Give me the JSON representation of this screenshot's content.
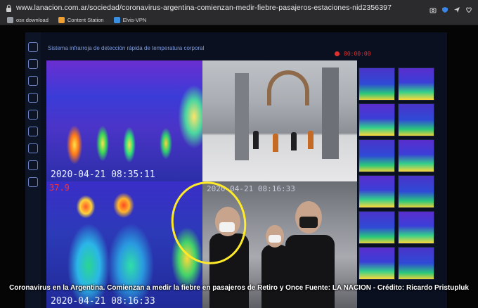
{
  "browser": {
    "url": "www.lanacion.com.ar/sociedad/coronavirus-argentina-comienzan-medir-fiebre-pasajeros-estaciones-nid2356397",
    "bookmarks": [
      {
        "label": "osx download",
        "icon": "tools-icon",
        "color": "#9aa0a6"
      },
      {
        "label": "Content Station",
        "icon": "content-station-icon",
        "color": "#f0a030"
      },
      {
        "label": "Elvis-VPN",
        "icon": "elvis-icon",
        "color": "#3a8fe0"
      }
    ]
  },
  "screen": {
    "system_title": "Sistema infrarroja de detección rápida de temperatura corporal",
    "timer": "00:00:00",
    "thermal_top_timestamp": "2020-04-21 08:35:11",
    "thermal_bottom_temp": "37.9",
    "thermal_bottom_timestamp": "2020-04-21 08:16:33",
    "camera_bottom_timestamp": "2020-04-21 08:16:33"
  },
  "caption": "Coronavirus en la Argentina. Comienzan a medir la fiebre en pasajeros de Retiro y Once Fuente: LA NACION - Crédito: Ricardo Pristupluk"
}
